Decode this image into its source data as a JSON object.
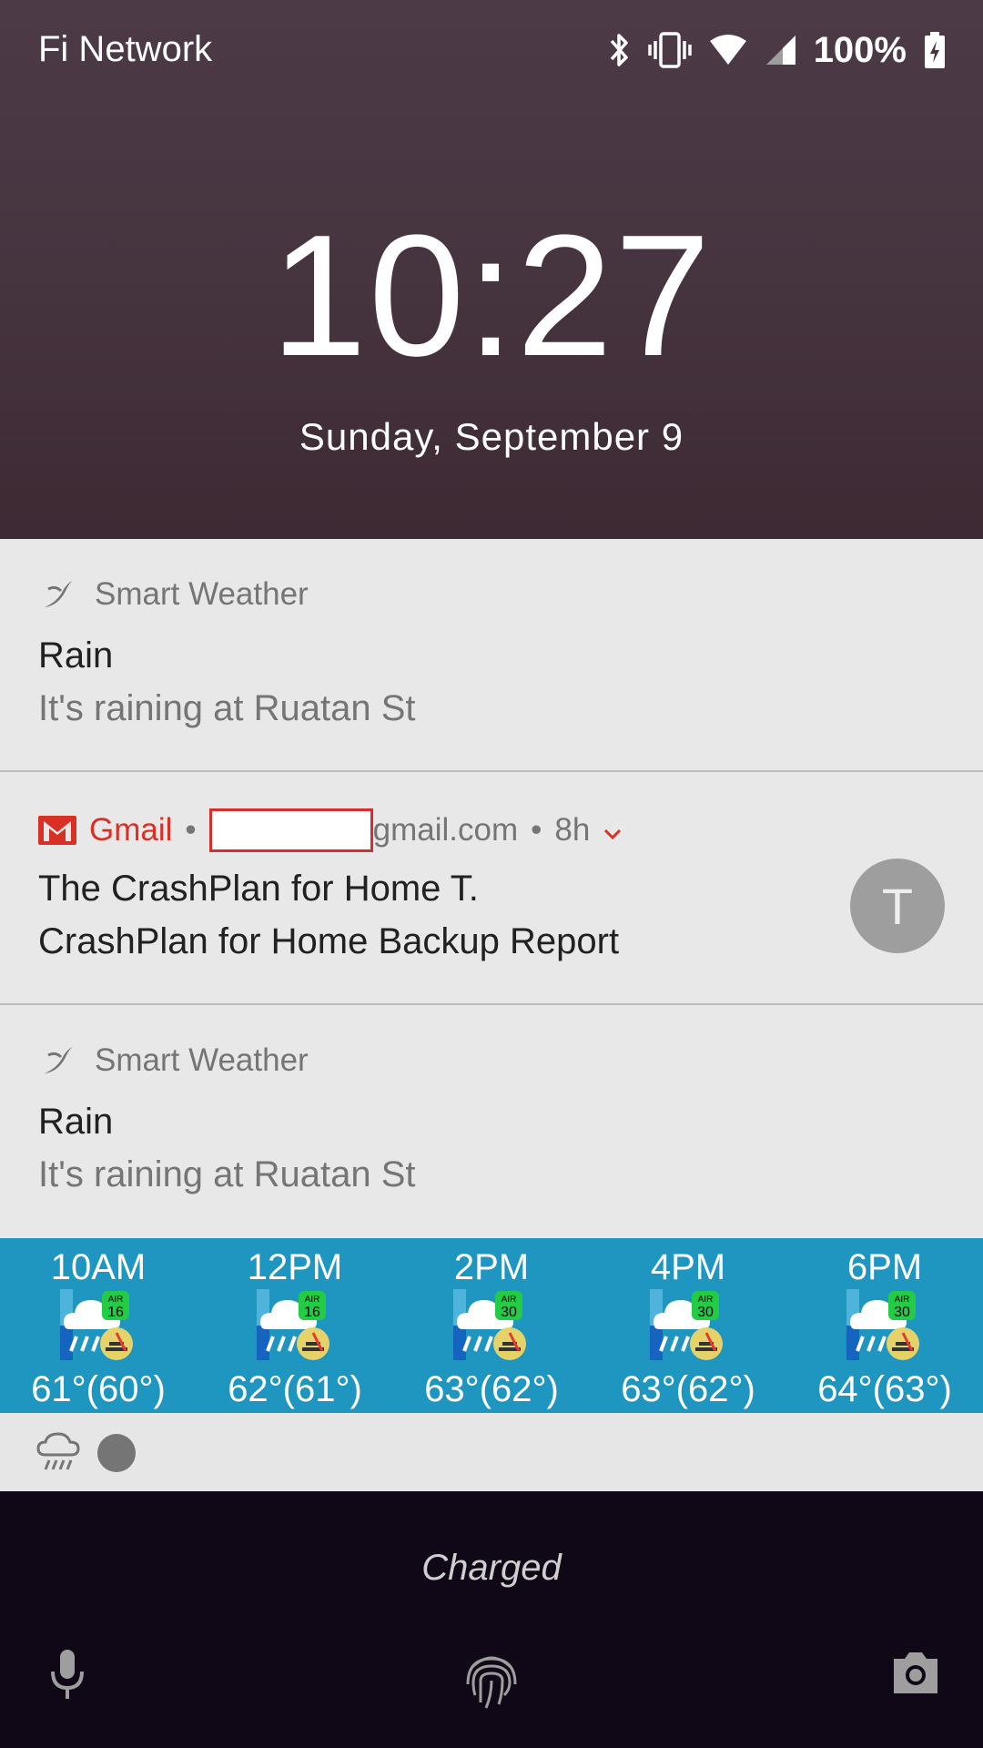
{
  "status_bar": {
    "carrier": "Fi Network",
    "battery_percent": "100%",
    "icons": [
      "bluetooth-icon",
      "vibrate-icon",
      "wifi-icon",
      "signal-icon",
      "battery-charging-icon"
    ]
  },
  "lockscreen": {
    "time": "10:27",
    "date": "Sunday, September 9"
  },
  "notifications": [
    {
      "app": "Smart Weather",
      "title": "Rain",
      "text": "It's raining at Ruatan St"
    },
    {
      "app": "Gmail",
      "account_suffix": "gmail.com",
      "age": "8h",
      "title": "The CrashPlan for Home T.",
      "text": "CrashPlan for Home Backup Report",
      "avatar_letter": "T"
    },
    {
      "app": "Smart Weather",
      "title": "Rain",
      "text": "It's raining at Ruatan St"
    }
  ],
  "weather_forecast": [
    {
      "time": "10AM",
      "air": "16",
      "temp": "61°(60°)",
      "air_label": "AIR"
    },
    {
      "time": "12PM",
      "air": "16",
      "temp": "62°(61°)",
      "air_label": "AIR"
    },
    {
      "time": "2PM",
      "air": "30",
      "temp": "63°(62°)",
      "air_label": "AIR"
    },
    {
      "time": "4PM",
      "air": "30",
      "temp": "63°(62°)",
      "air_label": "AIR"
    },
    {
      "time": "6PM",
      "air": "30",
      "temp": "64°(63°)",
      "air_label": "AIR"
    }
  ],
  "bottom": {
    "charging_status": "Charged"
  },
  "colors": {
    "gmail_red": "#d93025",
    "weather_blue": "#1e96c0",
    "air_badge_green": "#22cc44"
  }
}
